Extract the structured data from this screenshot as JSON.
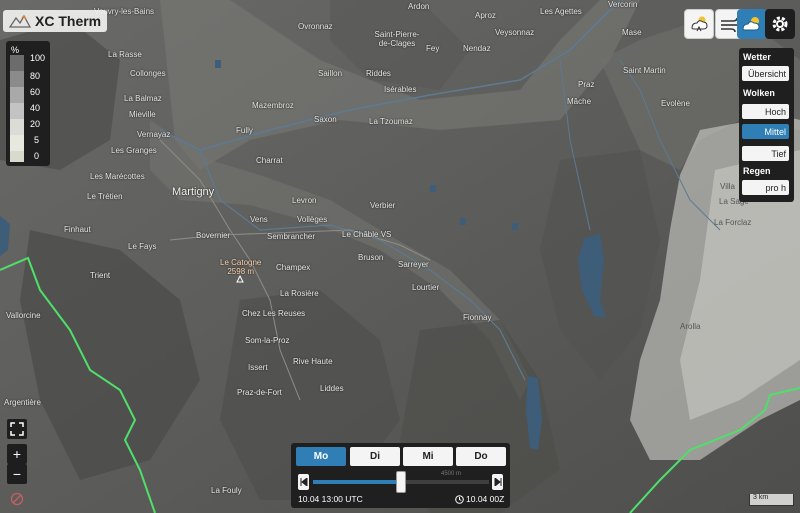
{
  "app": {
    "title": "XC Therm"
  },
  "legend": {
    "unit": "%",
    "levels": [
      "100",
      "80",
      "60",
      "40",
      "20",
      "5",
      "0"
    ],
    "colors": [
      "#6c6c6c",
      "#8b8b8b",
      "#a9a9a9",
      "#c3c3c3",
      "#dcdcd6",
      "#e8e9de",
      "#d8dacb"
    ]
  },
  "toolbar": {
    "icons": [
      "thermal-cloud-icon",
      "wind-icon",
      "cloud-layer-icon",
      "gear-icon"
    ],
    "active_index": 2
  },
  "panel": {
    "wetter_heading": "Wetter",
    "uebersicht": "Übersicht",
    "wolken_heading": "Wolken",
    "hoch": "Hoch",
    "mittel": "Mittel",
    "tief": "Tief",
    "regen_heading": "Regen",
    "pro_h": "pro h",
    "active": "Mittel"
  },
  "zoom": {
    "fullscreen": "⛶",
    "plus": "+",
    "minus": "−"
  },
  "timeline": {
    "days": [
      "Mo",
      "Di",
      "Mi",
      "Do"
    ],
    "active_day": "Mo",
    "position_fraction": 0.5,
    "left_time": "10.04 13:00 UTC",
    "right_time": "10.04 00Z",
    "altitude_hint": "4500 m"
  },
  "scale": {
    "label": "3 km"
  },
  "places": [
    {
      "name": "Vouvry-les-Bains"
    },
    {
      "name": "Ovronnaz"
    },
    {
      "name": "Ardon"
    },
    {
      "name": "Aproz"
    },
    {
      "name": "Les Agettes"
    },
    {
      "name": "Vercorin"
    },
    {
      "name": "Saint-Pierre-de-Clages"
    },
    {
      "name": "Fey"
    },
    {
      "name": "Nendaz"
    },
    {
      "name": "Veysonnaz"
    },
    {
      "name": "Mase"
    },
    {
      "name": "La Rasse"
    },
    {
      "name": "Collonges"
    },
    {
      "name": "Saillon"
    },
    {
      "name": "Riddes"
    },
    {
      "name": "Saint Martin"
    },
    {
      "name": "Isérables"
    },
    {
      "name": "Praz"
    },
    {
      "name": "La Balmaz"
    },
    {
      "name": "Mieville"
    },
    {
      "name": "Mazembroz"
    },
    {
      "name": "Evolène"
    },
    {
      "name": "Mâche"
    },
    {
      "name": "Vernayaz"
    },
    {
      "name": "Saxon"
    },
    {
      "name": "La Tzoumaz"
    },
    {
      "name": "Fully"
    },
    {
      "name": "Les Granges"
    },
    {
      "name": "Charrat"
    },
    {
      "name": "Les Marécottes"
    },
    {
      "name": "Le Trétien"
    },
    {
      "name": "Martigny"
    },
    {
      "name": "Levron"
    },
    {
      "name": "Verbier"
    },
    {
      "name": "Finhaut"
    },
    {
      "name": "Vens"
    },
    {
      "name": "Vollèges"
    },
    {
      "name": "Bovernier"
    },
    {
      "name": "Sembrancher"
    },
    {
      "name": "Le Châble VS"
    },
    {
      "name": "Le Fays"
    },
    {
      "name": "Bruson"
    },
    {
      "name": "Sarreyer"
    },
    {
      "name": "Trient"
    },
    {
      "name": "Champex"
    },
    {
      "name": "Lourtier"
    },
    {
      "name": "La Rosière"
    },
    {
      "name": "Vallorcine"
    },
    {
      "name": "Chez Les Reuses"
    },
    {
      "name": "Fionnay"
    },
    {
      "name": "Som-la-Proz"
    },
    {
      "name": "Rive Haute"
    },
    {
      "name": "Issert"
    },
    {
      "name": "Liddes"
    },
    {
      "name": "Praz-de-Fort"
    },
    {
      "name": "Argentière"
    },
    {
      "name": "Arolla"
    },
    {
      "name": "La Fouly"
    },
    {
      "name": "Villa"
    },
    {
      "name": "La Sage"
    },
    {
      "name": "La Forclaz"
    }
  ],
  "peak": {
    "name": "Le Catogne",
    "elevation": "2598 m"
  }
}
